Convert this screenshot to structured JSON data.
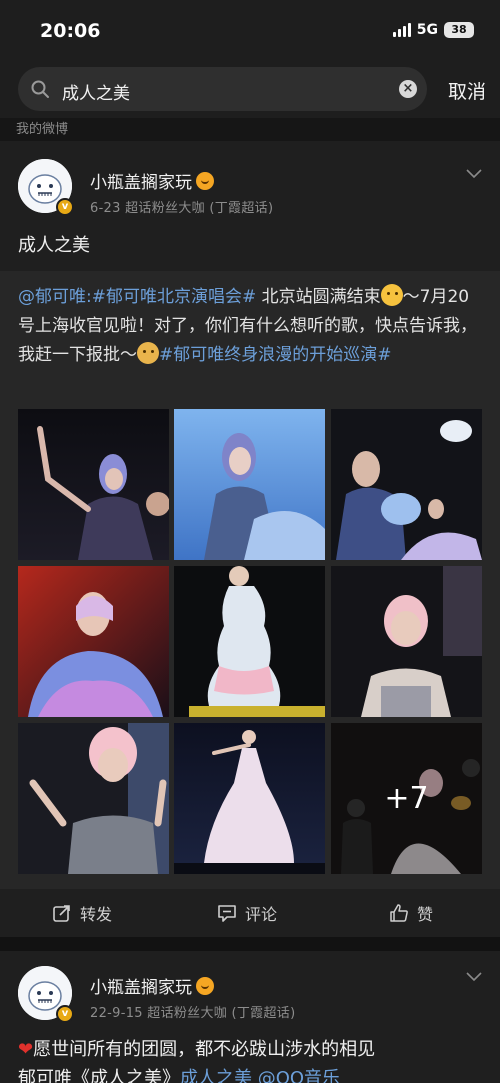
{
  "status": {
    "time": "20:06",
    "network": "5G",
    "battery": "38"
  },
  "search": {
    "query": "成人之美",
    "cancel": "取消"
  },
  "section_label": "我的微博",
  "post1": {
    "username": "小瓶盖搁家玩",
    "meta": "6-23  超话粉丝大咖 (丁霞超话)",
    "text": "成人之美",
    "repost": {
      "mention": "@郁可唯",
      "topic1": ":#郁可唯北京演唱会#",
      "body1": " 北京站圆满结束",
      "body2": "～7月20号上海收官见啦！对了，你们有什么想听的歌，快点告诉我，我赶一下报批～",
      "topic2": "#郁可唯终身浪漫的开始巡演#"
    },
    "more_photos": "+7",
    "actions": {
      "repost": "转发",
      "comment": "评论",
      "like": "赞"
    }
  },
  "post2": {
    "username": "小瓶盖搁家玩",
    "meta": "22-9-15  超话粉丝大咖 (丁霞超话)",
    "text_line1": "愿世间所有的团圆，都不必跋山涉水的相见",
    "text_line2": "郁可唯《成人之美》",
    "text_line2b": "成人之美 @QQ音乐"
  },
  "colors": {
    "background": "#161616",
    "card": "#1f1f1f",
    "repost": "#272727",
    "link": "#6c9fd9"
  }
}
